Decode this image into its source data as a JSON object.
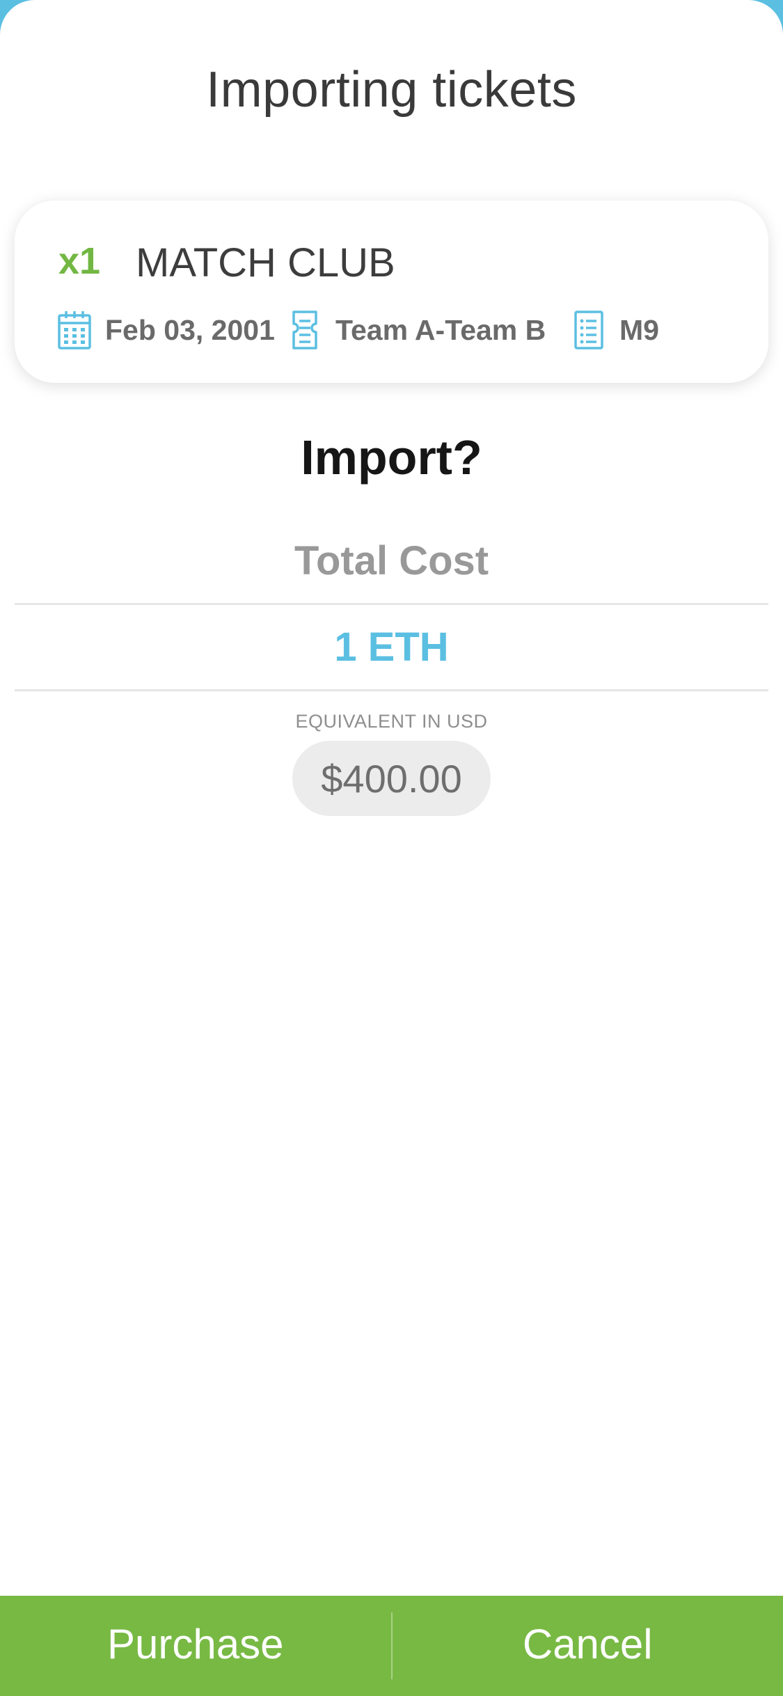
{
  "header": {
    "title": "Importing tickets"
  },
  "ticket": {
    "quantity": "x1",
    "event_name": "MATCH CLUB",
    "date": "Feb 03, 2001",
    "teams": "Team A-Team B",
    "match": "M9",
    "icons": {
      "date": "calendar-icon",
      "teams": "ticket-icon",
      "match": "list-document-icon"
    }
  },
  "confirm": {
    "question": "Import?",
    "total_cost_label": "Total Cost",
    "amount": "1 ETH",
    "equivalent_label": "EQUIVALENT IN USD",
    "usd_value": "$400.00"
  },
  "actions": {
    "purchase_label": "Purchase",
    "cancel_label": "Cancel"
  },
  "colors": {
    "accent_blue": "#5bbfe2",
    "accent_green": "#78b944",
    "quantity_green": "#72b743"
  }
}
